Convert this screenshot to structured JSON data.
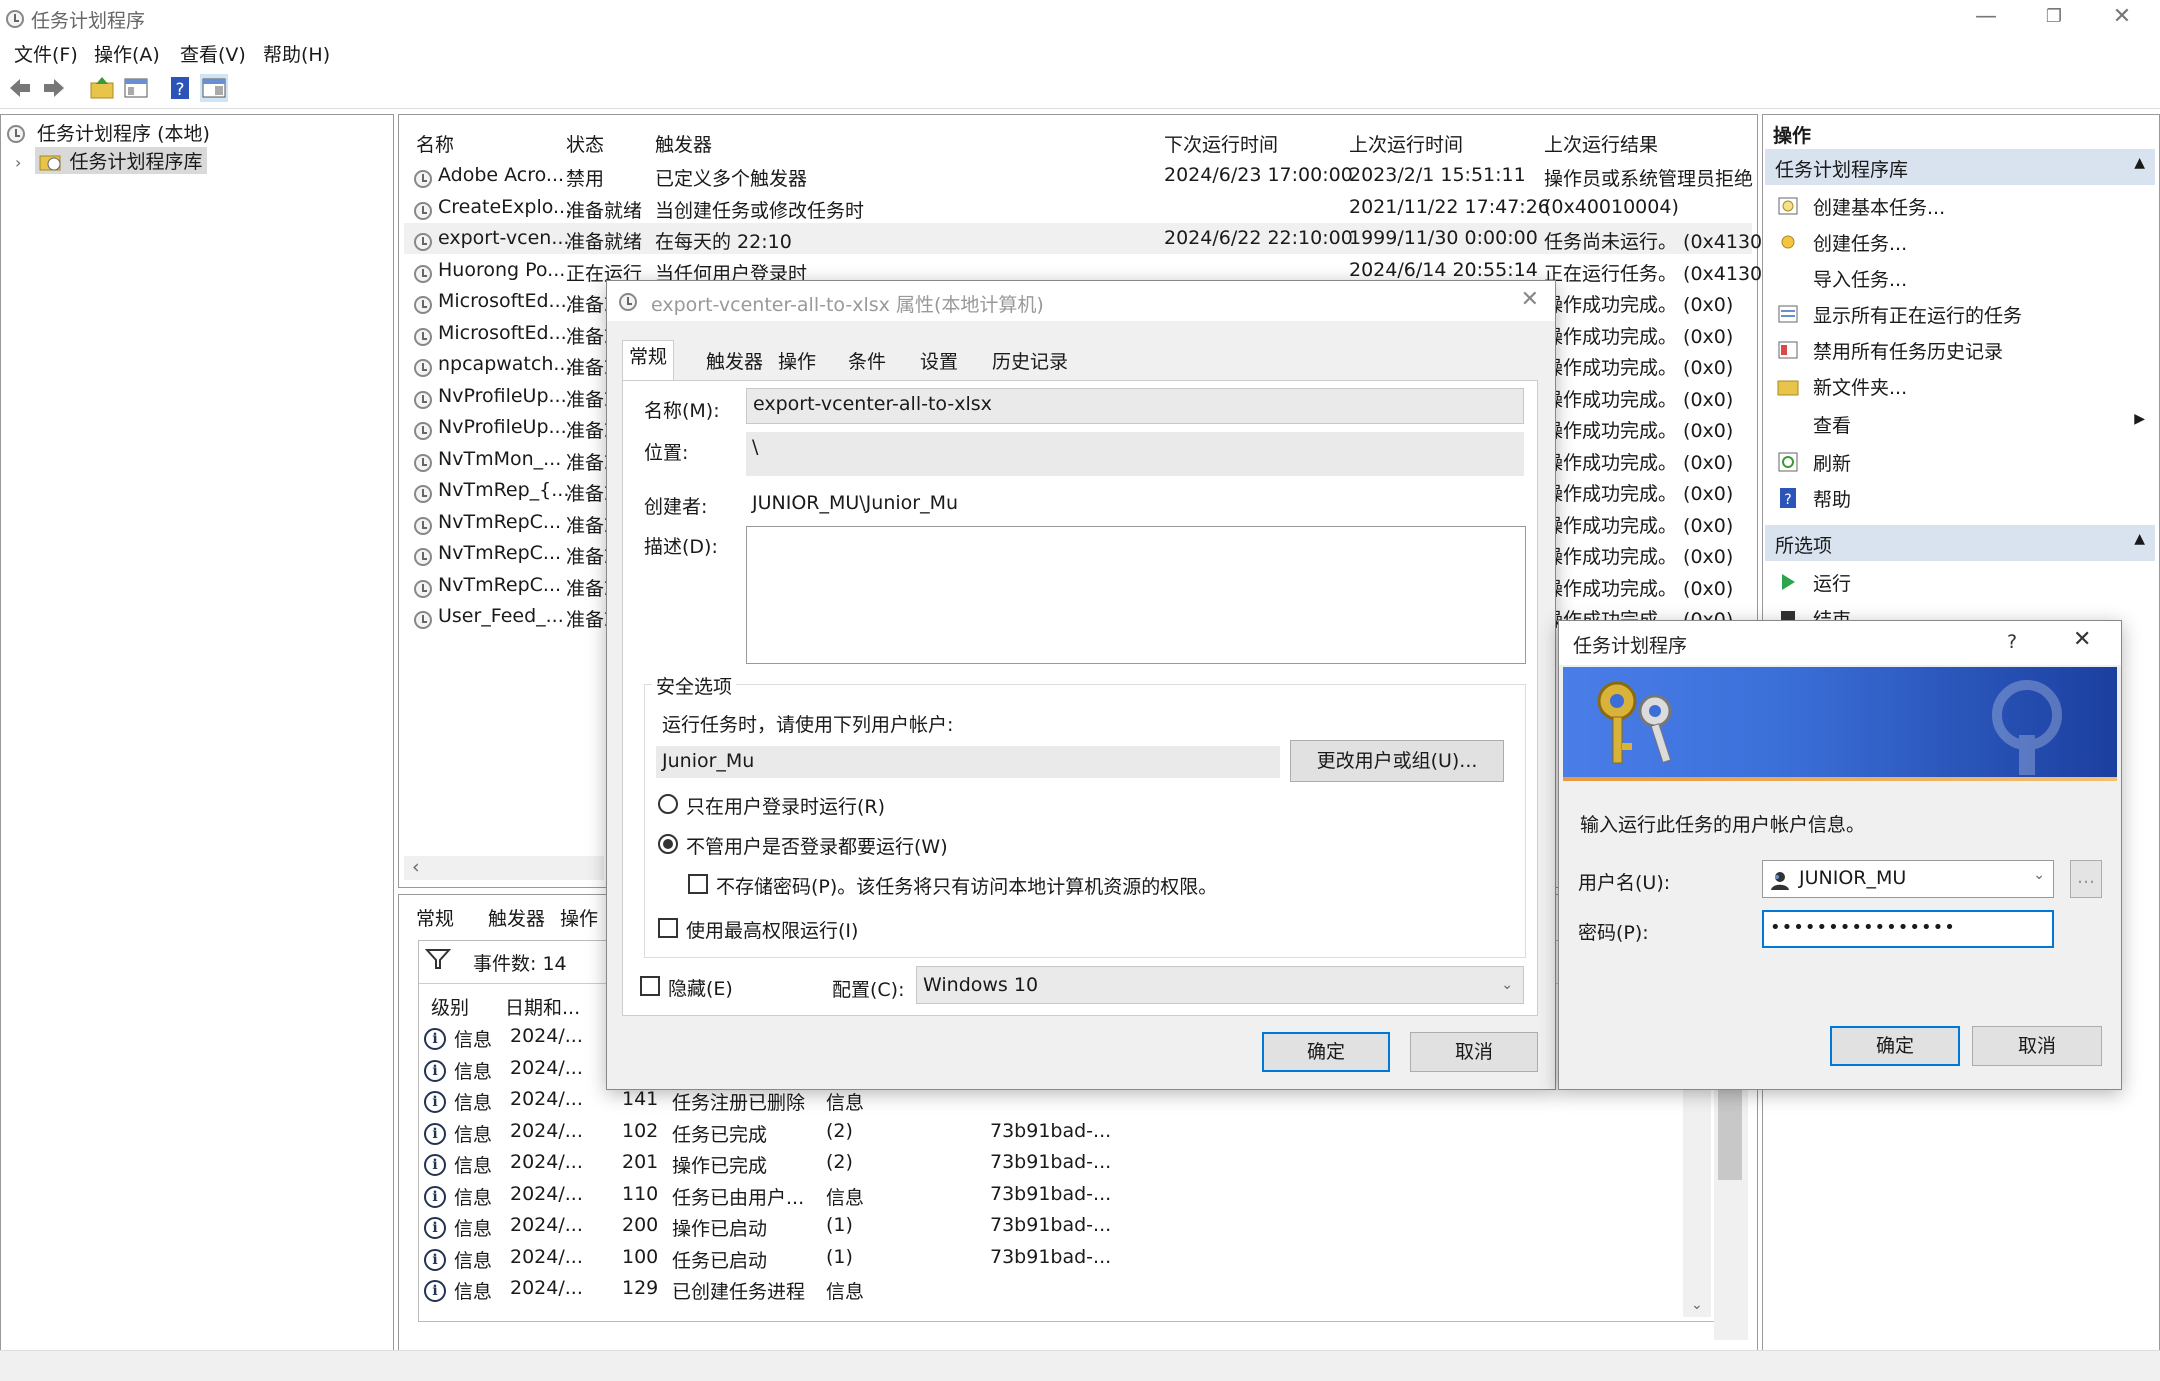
{
  "window": {
    "title": "任务计划程序",
    "menu": [
      "文件(F)",
      "操作(A)",
      "查看(V)",
      "帮助(H)"
    ]
  },
  "tree": {
    "root": "任务计划程序 (本地)",
    "library": "任务计划程序库"
  },
  "task_table": {
    "headers": [
      "名称",
      "状态",
      "触发器",
      "下次运行时间",
      "上次运行时间",
      "上次运行结果"
    ],
    "rows": [
      {
        "name": "Adobe Acro...",
        "status": "禁用",
        "trigger": "已定义多个触发器",
        "next": "2024/6/23 17:00:00",
        "last": "2023/2/1 15:51:11",
        "result": "操作员或系统管理员拒绝"
      },
      {
        "name": "CreateExplo...",
        "status": "准备就绪",
        "trigger": "当创建任务或修改任务时",
        "next": "",
        "last": "2021/11/22 17:47:26",
        "result": "(0x40010004)"
      },
      {
        "name": "export-vcen...",
        "status": "准备就绪",
        "trigger": "在每天的 22:10",
        "next": "2024/6/22 22:10:00",
        "last": "1999/11/30 0:00:00",
        "result": "任务尚未运行。 (0x41303"
      },
      {
        "name": "Huorong Po...",
        "status": "正在运行",
        "trigger": "当任何用户登录时",
        "next": "",
        "last": "2024/6/14 20:55:14",
        "result": "正在运行任务。 (0x41301"
      },
      {
        "name": "MicrosoftEd...",
        "status": "准备就绪",
        "trigger": "",
        "next": "",
        "last": "",
        "result": "操作成功完成。 (0x0)"
      },
      {
        "name": "MicrosoftEd...",
        "status": "准备就绪",
        "trigger": "",
        "next": "",
        "last": "",
        "result": "操作成功完成。 (0x0)"
      },
      {
        "name": "npcapwatch...",
        "status": "准备就绪",
        "trigger": "",
        "next": "",
        "last": "",
        "result": "操作成功完成。 (0x0)"
      },
      {
        "name": "NvProfileUp...",
        "status": "准备就绪",
        "trigger": "",
        "next": "",
        "last": "",
        "result": "操作成功完成。 (0x0)"
      },
      {
        "name": "NvProfileUp...",
        "status": "准备就绪",
        "trigger": "",
        "next": "",
        "last": "",
        "result": "操作成功完成。 (0x0)"
      },
      {
        "name": "NvTmMon_...",
        "status": "准备就绪",
        "trigger": "",
        "next": "",
        "last": "",
        "result": "操作成功完成。 (0x0)"
      },
      {
        "name": "NvTmRep_{...",
        "status": "准备就绪",
        "trigger": "",
        "next": "",
        "last": "",
        "result": "操作成功完成。 (0x0)"
      },
      {
        "name": "NvTmRepC...",
        "status": "准备就绪",
        "trigger": "",
        "next": "",
        "last": "",
        "result": "操作成功完成。 (0x0)"
      },
      {
        "name": "NvTmRepC...",
        "status": "准备就绪",
        "trigger": "",
        "next": "",
        "last": "",
        "result": "操作成功完成。 (0x0)"
      },
      {
        "name": "NvTmRepC...",
        "status": "准备就绪",
        "trigger": "",
        "next": "",
        "last": "",
        "result": "操作成功完成。 (0x0)"
      },
      {
        "name": "User_Feed_...",
        "status": "准备就绪",
        "trigger": "",
        "next": "",
        "last": "",
        "result": "操作成功完成。 (0x0)"
      }
    ]
  },
  "bottom_tabs": [
    "常规",
    "触发器",
    "操作"
  ],
  "events": {
    "count_label": "事件数: 14",
    "headers": [
      "级别",
      "日期和..."
    ],
    "rows": [
      {
        "level": "信息",
        "date": "2024/...",
        "id": "",
        "cat": "",
        "op": "",
        "corr": ""
      },
      {
        "level": "信息",
        "date": "2024/...",
        "id": "",
        "cat": "",
        "op": "",
        "corr": ""
      },
      {
        "level": "信息",
        "date": "2024/...",
        "id": "141",
        "cat": "任务注册已删除",
        "op": "信息",
        "corr": ""
      },
      {
        "level": "信息",
        "date": "2024/...",
        "id": "102",
        "cat": "任务已完成",
        "op": "(2)",
        "corr": "73b91bad-..."
      },
      {
        "level": "信息",
        "date": "2024/...",
        "id": "201",
        "cat": "操作已完成",
        "op": "(2)",
        "corr": "73b91bad-..."
      },
      {
        "level": "信息",
        "date": "2024/...",
        "id": "110",
        "cat": "任务已由用户...",
        "op": "信息",
        "corr": "73b91bad-..."
      },
      {
        "level": "信息",
        "date": "2024/...",
        "id": "200",
        "cat": "操作已启动",
        "op": "(1)",
        "corr": "73b91bad-..."
      },
      {
        "level": "信息",
        "date": "2024/...",
        "id": "100",
        "cat": "任务已启动",
        "op": "(1)",
        "corr": "73b91bad-..."
      },
      {
        "level": "信息",
        "date": "2024/...",
        "id": "129",
        "cat": "已创建任务进程",
        "op": "信息",
        "corr": ""
      }
    ]
  },
  "actions": {
    "header": "操作",
    "library_section": "任务计划程序库",
    "library_items": [
      "创建基本任务...",
      "创建任务...",
      "导入任务...",
      "显示所有正在运行的任务",
      "禁用所有任务历史记录",
      "新文件夹...",
      "查看",
      "刷新",
      "帮助"
    ],
    "selected_section": "所选项",
    "selected_items": [
      "运行",
      "结束"
    ]
  },
  "props_dialog": {
    "title": "export-vcenter-all-to-xlsx 属性(本地计算机)",
    "tabs": [
      "常规",
      "触发器",
      "操作",
      "条件",
      "设置",
      "历史记录"
    ],
    "name_label": "名称(M):",
    "name_value": "export-vcenter-all-to-xlsx",
    "location_label": "位置:",
    "location_value": "\\",
    "author_label": "创建者:",
    "author_value": "JUNIOR_MU\\Junior_Mu",
    "desc_label": "描述(D):",
    "security_group": "安全选项",
    "run_as_label": "运行任务时，请使用下列用户帐户:",
    "run_as_value": "Junior_Mu",
    "change_user_btn": "更改用户或组(U)...",
    "radio_logged_on": "只在用户登录时运行(R)",
    "radio_always": "不管用户是否登录都要运行(W)",
    "no_store_pwd": "不存储密码(P)。该任务将只有访问本地计算机资源的权限。",
    "highest_priv": "使用最高权限运行(I)",
    "hidden": "隐藏(E)",
    "config_label": "配置(C):",
    "config_value": "Windows 10",
    "ok": "确定",
    "cancel": "取消"
  },
  "cred_dialog": {
    "title": "任务计划程序",
    "help": "?",
    "prompt": "输入运行此任务的用户帐户信息。",
    "user_label": "用户名(U):",
    "user_value": "JUNIOR_MU",
    "browse": "...",
    "pwd_label": "密码(P):",
    "pwd_value": "••••••••••••••••",
    "ok": "确定",
    "cancel": "取消"
  },
  "colors": {
    "accent": "#0078d7",
    "section_bg": "#d9e3f0",
    "banner_start": "#3b6fd8",
    "banner_end": "#1b3f9f"
  }
}
